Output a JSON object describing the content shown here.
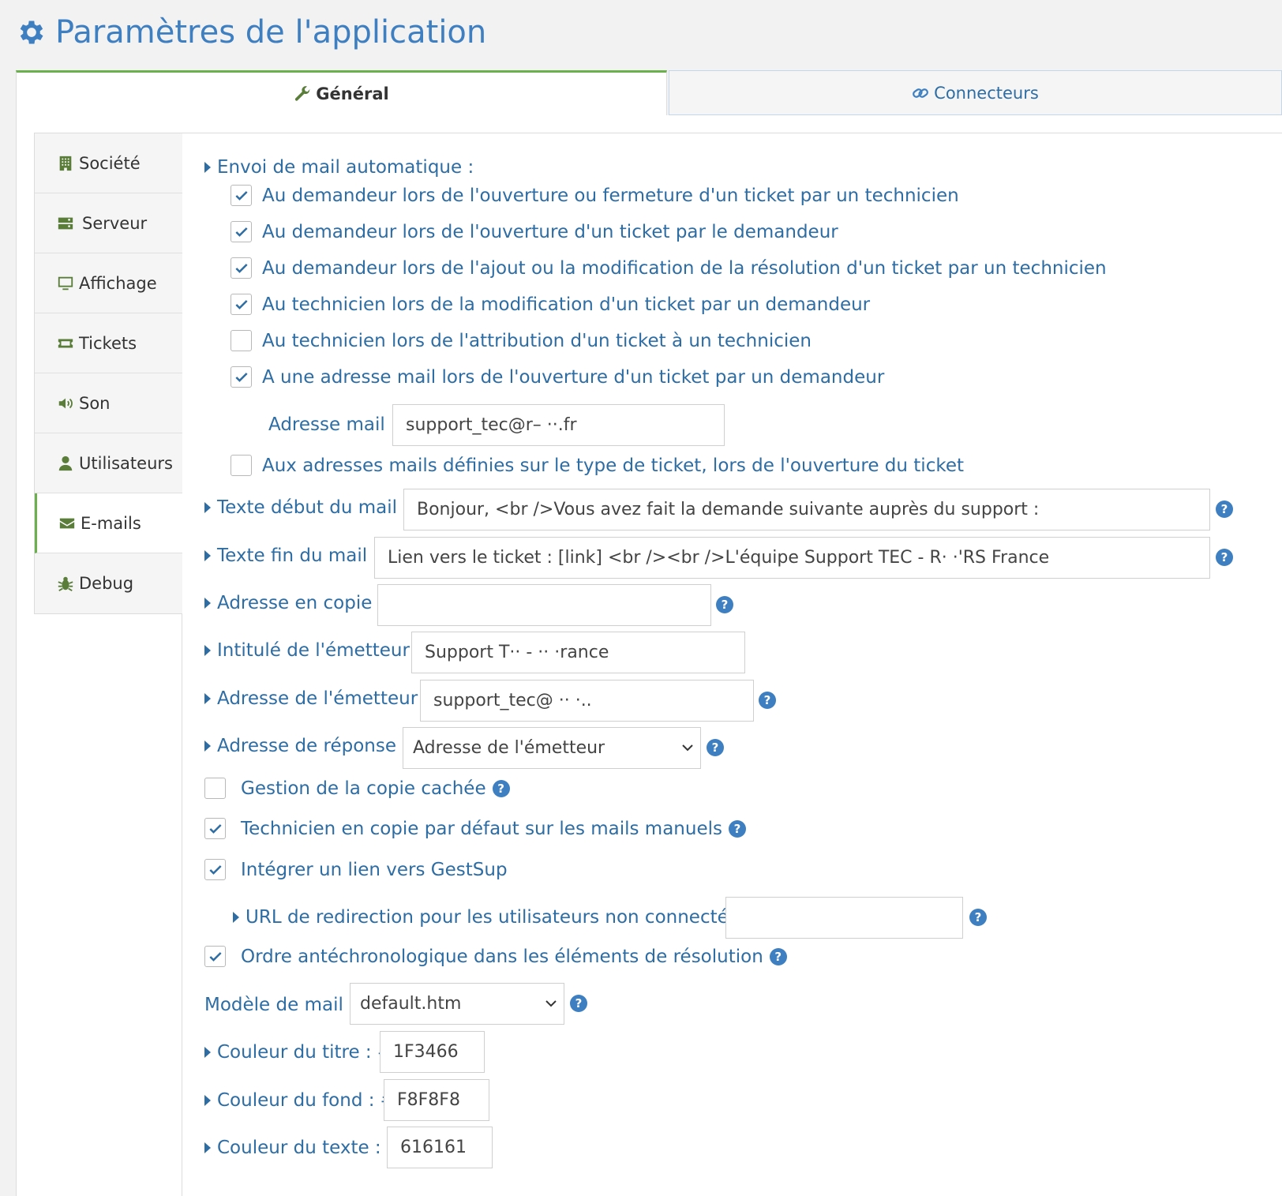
{
  "page": {
    "title": "Paramètres de l'application"
  },
  "tabs": {
    "general": "Général",
    "connecteurs": "Connecteurs"
  },
  "sidebar": {
    "items": [
      {
        "label": "Société",
        "icon": "building-icon"
      },
      {
        "label": "Serveur",
        "icon": "server-icon"
      },
      {
        "label": "Affichage",
        "icon": "monitor-icon"
      },
      {
        "label": "Tickets",
        "icon": "ticket-icon"
      },
      {
        "label": "Son",
        "icon": "speaker-icon"
      },
      {
        "label": "Utilisateurs",
        "icon": "user-icon"
      },
      {
        "label": "E-mails",
        "icon": "envelope-icon"
      },
      {
        "label": "Debug",
        "icon": "bug-icon"
      }
    ],
    "active": "E-mails"
  },
  "email": {
    "auto_heading": "Envoi de mail automatique :",
    "auto_options": [
      {
        "label": "Au demandeur lors de l'ouverture ou fermeture d'un ticket par un technicien",
        "checked": true
      },
      {
        "label": "Au demandeur lors de l'ouverture d'un ticket par le demandeur",
        "checked": true
      },
      {
        "label": "Au demandeur lors de l'ajout ou la modification de la résolution d'un ticket par un technicien",
        "checked": true
      },
      {
        "label": "Au technicien lors de la modification d'un ticket par un demandeur",
        "checked": true
      },
      {
        "label": "Au technicien lors de l'attribution d'un ticket à un technicien",
        "checked": false
      },
      {
        "label": "A une adresse mail lors de l'ouverture d'un ticket par un demandeur",
        "checked": true
      }
    ],
    "address_label": "Adresse mail :",
    "address_value": "support_tec@r–      ··.fr",
    "type_addresses": {
      "label": "Aux adresses mails définies sur le type de ticket, lors de l'ouverture du ticket",
      "checked": false
    },
    "start_text_label": "Texte début du mail :",
    "start_text_value": "Bonjour, <br />Vous avez fait la demande suivante auprès du support :",
    "end_text_label": "Texte fin du mail :",
    "end_text_value": "Lien vers le ticket : [link] <br /><br />L'équipe Support TEC - R·       ·'RS France",
    "cc_label": "Adresse en copie :",
    "cc_value": "",
    "sender_name_label": "Intitulé de l'émetteur :",
    "sender_name_value": "Support T·· - ··        ·rance",
    "sender_addr_label": "Adresse de l'émetteur :",
    "sender_addr_value": "support_tec@ ··      ·..",
    "reply_label": "Adresse de réponse :",
    "reply_value": "Adresse de l'émetteur",
    "bcc": {
      "label": "Gestion de la copie cachée",
      "checked": false
    },
    "tech_cc": {
      "label": "Technicien en copie par défaut sur les mails manuels",
      "checked": true
    },
    "gestsup_link": {
      "label": "Intégrer un lien vers GestSup",
      "checked": true
    },
    "redirect_label": "URL de redirection pour les utilisateurs non connectés :",
    "redirect_value": "",
    "antechrono": {
      "label": "Ordre antéchronologique dans les éléments de résolution",
      "checked": true
    },
    "template_label": "Modèle de mail :",
    "template_value": "default.htm",
    "title_color_label": "Couleur du titre : #",
    "title_color_value": "1F3466",
    "bg_color_label": "Couleur du fond : #",
    "bg_color_value": "F8F8F8",
    "text_color_label": "Couleur du texte : #",
    "text_color_value": "616161",
    "help_glyph": "?"
  },
  "colors": {
    "accent": "#2e6da4",
    "active_tab": "#6ab04c",
    "icon_green": "#5a7d3a",
    "help": "#3e7fc1"
  }
}
